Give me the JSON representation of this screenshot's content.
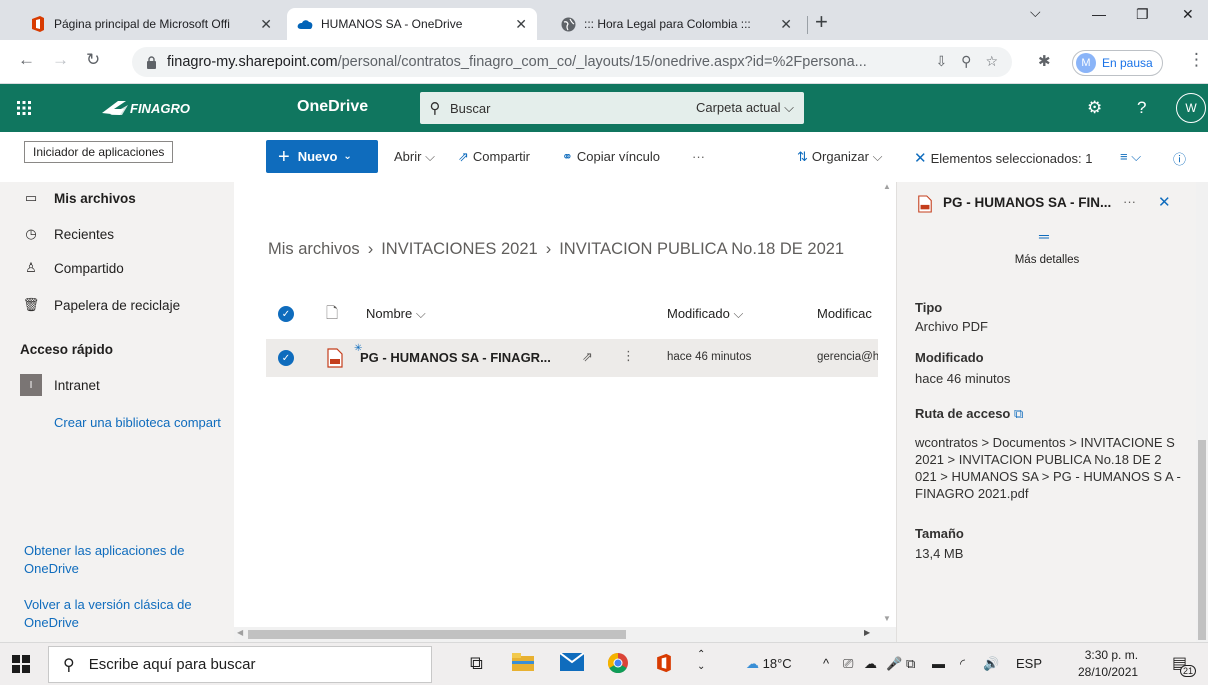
{
  "browser": {
    "tabs": [
      {
        "title": "Página principal de Microsoft Offi",
        "active": false
      },
      {
        "title": "HUMANOS SA - OneDrive",
        "active": true
      },
      {
        "title": "::: Hora Legal para Colombia :::",
        "active": false
      }
    ],
    "url_domain": "finagro-my.sharepoint.com",
    "url_path": "/personal/contratos_finagro_com_co/_layouts/15/onedrive.aspx?id=%2Fpersona...",
    "profile_initial": "M",
    "profile_status": "En pausa"
  },
  "suite": {
    "brand": "FINAGRO",
    "app_name": "OneDrive",
    "search_placeholder": "Buscar",
    "search_scope": "Carpeta actual",
    "help": "?",
    "user_initial": "W"
  },
  "commandbar": {
    "tooltip": "Iniciador de aplicaciones",
    "new": "Nuevo",
    "open": "Abrir",
    "share": "Compartir",
    "copy_link": "Copiar vínculo",
    "more": "···",
    "organize": "Organizar",
    "selected": "Elementos seleccionados: 1"
  },
  "nav": {
    "items": [
      {
        "label": "Mis archivos",
        "icon": "folder-icon"
      },
      {
        "label": "Recientes",
        "icon": "clock-icon"
      },
      {
        "label": "Compartido",
        "icon": "people-icon"
      },
      {
        "label": "Papelera de reciclaje",
        "icon": "trash-icon"
      }
    ],
    "quick_access_heading": "Acceso rápido",
    "intranet_badge": "I",
    "intranet": "Intranet",
    "create_library": "Crear una biblioteca compart",
    "get_apps": "Obtener las aplicaciones de OneDrive",
    "classic": "Volver a la versión clásica de OneDrive"
  },
  "main": {
    "breadcrumb": [
      "Mis archivos",
      "INVITACIONES 2021",
      "INVITACION PUBLICA No.18 DE 2021"
    ],
    "columns": {
      "name": "Nombre",
      "modified": "Modificado",
      "modified_by": "Modificac"
    },
    "files": [
      {
        "name": "PG - HUMANOS SA - FINAGR...",
        "modified": "hace 46 minutos",
        "modified_by": "gerencia@h",
        "selected": true
      }
    ]
  },
  "details": {
    "title": "PG - HUMANOS SA - FIN...",
    "more_details": "Más detalles",
    "type_label": "Tipo",
    "type_value": "Archivo PDF",
    "modified_label": "Modificado",
    "modified_value": "hace 46 minutos",
    "path_label": "Ruta de acceso",
    "path_value": "wcontratos > Documentos > INVITACIONE S 2021 > INVITACION PUBLICA No.18 DE 2 021 > HUMANOS SA > PG - HUMANOS S A - FINAGRO 2021.pdf",
    "size_label": "Tamaño",
    "size_value": "13,4 MB"
  },
  "taskbar": {
    "search_placeholder": "Escribe aquí para buscar",
    "temperature": "18°C",
    "language": "ESP",
    "time": "3:30 p. m.",
    "date": "28/10/2021",
    "notifications": "21"
  },
  "colors": {
    "suite_header": "#10765f",
    "accent": "#0f6cbd",
    "nav_bg": "#f3f2f1"
  }
}
